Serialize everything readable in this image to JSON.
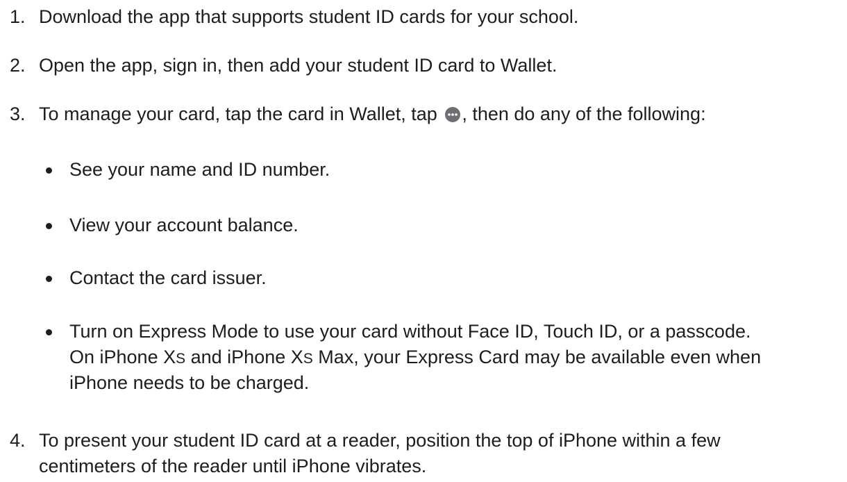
{
  "steps": [
    {
      "number": "1.",
      "text": "Download the app that supports student ID cards for your school."
    },
    {
      "number": "2.",
      "text": "Open the app, sign in, then add your student ID card to Wallet."
    },
    {
      "number": "3.",
      "text_before_icon": "To manage your card, tap the card in Wallet, tap",
      "icon": "more-icon",
      "text_after_icon": ", then do any of the following:"
    },
    {
      "number": "4.",
      "line1": "To present your student ID card at a reader, position the top of iPhone within a few",
      "line2": "centimeters of the reader until iPhone vibrates."
    }
  ],
  "bullets": [
    {
      "text": "See your name and ID number."
    },
    {
      "text": "View your account balance."
    },
    {
      "text": "Contact the card issuer."
    },
    {
      "line1": "Turn on Express Mode to use your card without Face ID, Touch ID, or a passcode.",
      "line2_a": "On iPhone X",
      "line2_b": "S",
      "line2_c": " and iPhone X",
      "line2_d": "S",
      "line2_e": " Max, your Express Card may be available even when",
      "line3": "iPhone needs to be charged."
    }
  ]
}
